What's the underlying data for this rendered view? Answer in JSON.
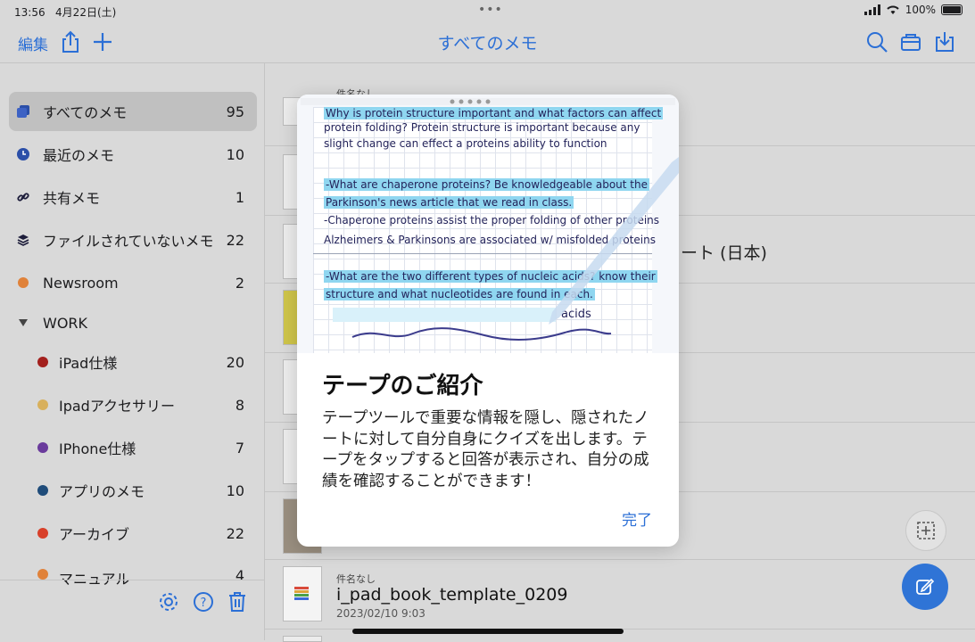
{
  "status": {
    "time": "13:56",
    "date": "4月22日(土)",
    "battery": "100%"
  },
  "nav": {
    "edit": "編集",
    "title": "すべてのメモ",
    "icons": [
      "share-icon",
      "plus-icon",
      "search-icon",
      "folder-icon",
      "import-icon"
    ]
  },
  "sidebar": {
    "items": [
      {
        "label": "すべてのメモ",
        "count": "95",
        "icon": "notes-icon"
      },
      {
        "label": "最近のメモ",
        "count": "10",
        "icon": "clock-icon"
      },
      {
        "label": "共有メモ",
        "count": "1",
        "icon": "link-icon"
      },
      {
        "label": "ファイルされていないメモ",
        "count": "22",
        "icon": "stack-icon"
      },
      {
        "label": "Newsroom",
        "count": "2",
        "color": "#e0823a"
      },
      {
        "label": "WORK",
        "count": ""
      },
      {
        "label": "iPad仕様",
        "count": "20",
        "color": "#a3201d"
      },
      {
        "label": "Ipadアクセサリー",
        "count": "8",
        "color": "#d8b05c"
      },
      {
        "label": "IPhone仕様",
        "count": "7",
        "color": "#6a3b9c"
      },
      {
        "label": "アプリのメモ",
        "count": "10",
        "color": "#1f4c7a"
      },
      {
        "label": "アーカイブ",
        "count": "22",
        "color": "#d8402a"
      },
      {
        "label": "マニュアル",
        "count": "4",
        "color": "#e0823a"
      }
    ]
  },
  "list": {
    "partial_title_1": "件名なし",
    "partial_title_2": "ート (日本)",
    "last_item": {
      "label": "件名なし",
      "title": "i_pad_book_template_0209",
      "date": "2023/02/10 9:03"
    }
  },
  "modal": {
    "title": "テープのご紹介",
    "body": "テープツールで重要な情報を隠し、隠されたノートに対して自分自身にクイズを出します。テープをタップすると回答が表示され、自分の成績を確認することができます！",
    "done": "完了",
    "preview_lines": [
      "Why is protein structure important and what factors can affect",
      "protein folding?  Protein structure is important because any",
      "slight change can effect a proteins ability to function",
      "-What are chaperone proteins? Be knowledgeable about the",
      "Parkinson's news article that we read in class.",
      "-Chaperone proteins assist the proper folding of other proteins",
      "Alzheimers & Parkinsons are associated w/ misfolded proteins",
      "-What are the two different types of nucleic acids? know their",
      "structure and what nucleotides are found in each.",
      "acids"
    ]
  }
}
